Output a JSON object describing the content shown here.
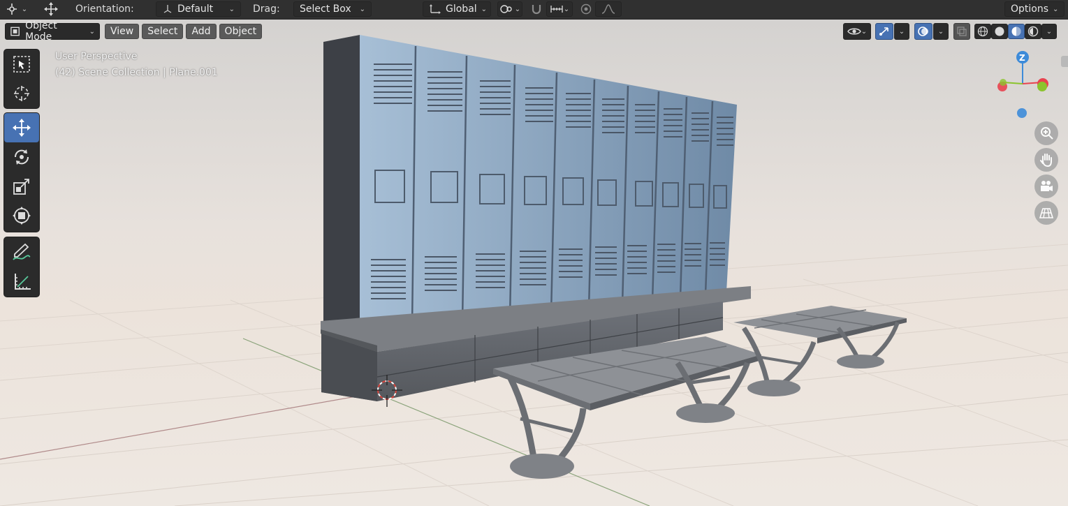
{
  "header": {
    "orientation_label": "Orientation:",
    "orientation_value": "Default",
    "drag_label": "Drag:",
    "drag_value": "Select Box",
    "transform_space": "Global",
    "options_label": "Options"
  },
  "viewport_header": {
    "mode": "Object Mode",
    "menus": [
      "View",
      "Select",
      "Add",
      "Object"
    ]
  },
  "viewport_info": {
    "perspective": "User Perspective",
    "collection": "(42) Scene Collection | Plane.001"
  },
  "gizmo": {
    "z_label": "Z",
    "x_color": "#e8434f",
    "y_color": "#8bc42d",
    "z_color": "#3d8bd9"
  },
  "toolbar": {
    "tools": [
      "select-box",
      "cursor",
      "move",
      "rotate",
      "scale",
      "transform",
      "annotate",
      "measure"
    ],
    "active": "move"
  },
  "navigation": [
    "zoom",
    "pan",
    "camera",
    "ortho-toggle"
  ],
  "colors": {
    "accent": "#4772b3",
    "header_bg": "#303030",
    "panel_bg": "#2b2b2b"
  }
}
